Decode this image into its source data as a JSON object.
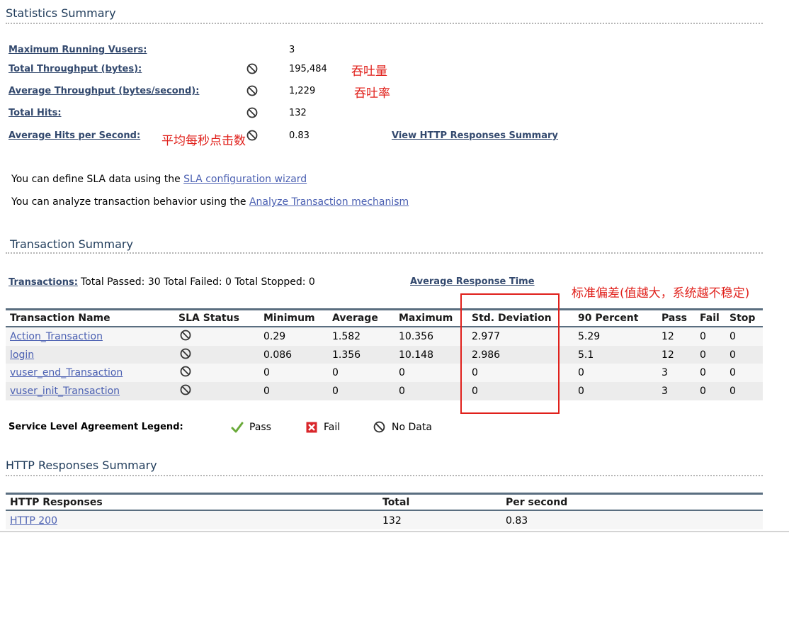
{
  "stats": {
    "heading": "Statistics Summary",
    "items": [
      {
        "label": "Maximum Running Vusers:",
        "value": "3",
        "nodata": false
      },
      {
        "label": "Total Throughput (bytes):",
        "value": "195,484",
        "nodata": true,
        "note": "吞吐量"
      },
      {
        "label": "Average Throughput (bytes/second):",
        "value": "1,229",
        "nodata": true,
        "note": "吞吐率"
      },
      {
        "label": "Total Hits:",
        "value": "132",
        "nodata": true
      },
      {
        "label": "Average Hits per Second:",
        "value": "0.83",
        "nodata": true,
        "note": "平均每秒点击数"
      }
    ],
    "http_link": "View HTTP Responses Summary"
  },
  "sla": {
    "line1_text": "You can define SLA data using the ",
    "line1_link": "SLA configuration wizard",
    "line2_text": "You can analyze transaction behavior using the ",
    "line2_link": "Analyze Transaction mechanism"
  },
  "transactions": {
    "heading": "Transaction Summary",
    "label": "Transactions:",
    "summary": "Total Passed: 30 Total Failed: 0 Total Stopped: 0",
    "avg_link": "Average Response Time",
    "annotation": "标准偏差(值越大，系统越不稳定)",
    "columns": [
      "Transaction Name",
      "SLA Status",
      "Minimum",
      "Average",
      "Maximum",
      "Std. Deviation",
      "90 Percent",
      "Pass",
      "Fail",
      "Stop"
    ],
    "rows": [
      {
        "name": "Action_Transaction",
        "min": "0.29",
        "avg": "1.582",
        "max": "10.356",
        "std": "2.977",
        "p90": "5.29",
        "pass": "12",
        "fail": "0",
        "stop": "0"
      },
      {
        "name": "login",
        "min": "0.086",
        "avg": "1.356",
        "max": "10.148",
        "std": "2.986",
        "p90": "5.1",
        "pass": "12",
        "fail": "0",
        "stop": "0"
      },
      {
        "name": "vuser_end_Transaction",
        "min": "0",
        "avg": "0",
        "max": "0",
        "std": "0",
        "p90": "0",
        "pass": "3",
        "fail": "0",
        "stop": "0"
      },
      {
        "name": "vuser_init_Transaction",
        "min": "0",
        "avg": "0",
        "max": "0",
        "std": "0",
        "p90": "0",
        "pass": "3",
        "fail": "0",
        "stop": "0"
      }
    ]
  },
  "legend": {
    "title": "Service Level Agreement Legend:",
    "pass": "Pass",
    "fail": "Fail",
    "nodata": "No Data"
  },
  "http": {
    "heading": "HTTP Responses Summary",
    "columns": [
      "HTTP Responses",
      "Total",
      "Per second"
    ],
    "rows": [
      {
        "name": "HTTP 200",
        "total": "132",
        "per_second": "0.83"
      }
    ]
  },
  "colors": {
    "link": "#4b60b2",
    "annotation": "#e0201b",
    "heading": "#1f3b5a"
  }
}
